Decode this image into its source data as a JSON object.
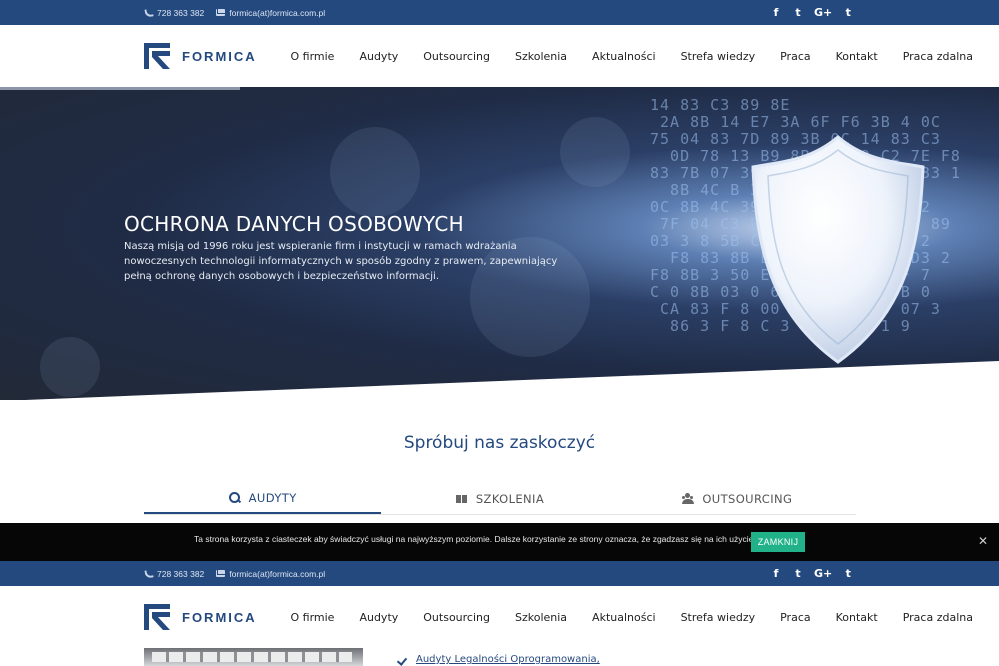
{
  "topbar": {
    "phone": "728 363 382",
    "email": "formica(at)formica.com.pl",
    "social": [
      {
        "icon": "facebook-icon",
        "glyph": "f"
      },
      {
        "icon": "twitter-icon",
        "glyph": "t"
      },
      {
        "icon": "google-plus-icon",
        "glyph": "G+"
      },
      {
        "icon": "tumblr-icon",
        "glyph": "t"
      }
    ]
  },
  "logo": {
    "text": "FORMICA"
  },
  "nav": {
    "items": [
      "O firmie",
      "Audyty",
      "Outsourcing",
      "Szkolenia",
      "Aktualności",
      "Strefa wiedzy",
      "Praca",
      "Kontakt",
      "Praca zdalna"
    ]
  },
  "hero": {
    "title": "OCHRONA DANYCH OSOBOWYCH",
    "text": "Naszą misją od 1996 roku jest wspieranie firm i instytucji w ramach wdrażania nowoczesnych technologii informatycznych w sposób zgodny z prawem, zapewniający pełną ochronę danych osobowych i bezpieczeństwo informacji."
  },
  "section": {
    "title": "Spróbuj nas zaskoczyć"
  },
  "tabs": [
    {
      "label": "AUDYTY",
      "icon": "search-icon",
      "active": true
    },
    {
      "label": "SZKOLENIA",
      "icon": "book-icon",
      "active": false
    },
    {
      "label": "OUTSOURCING",
      "icon": "users-icon",
      "active": false
    }
  ],
  "cookie": {
    "text": "Ta strona korzysta z ciasteczek aby świadczyć usługi na najwyższym poziomie. Dalsze korzystanie ze strony oznacza, że zgadzasz się na ich użycie.",
    "button": "ZAMKNIJ",
    "close_glyph": "✕"
  },
  "list": {
    "first_item": "Audyty Legalności Oprogramowania,"
  },
  "colors": {
    "brand": "#24497f",
    "accent": "#21b28a",
    "cookie_bg": "#060606"
  }
}
